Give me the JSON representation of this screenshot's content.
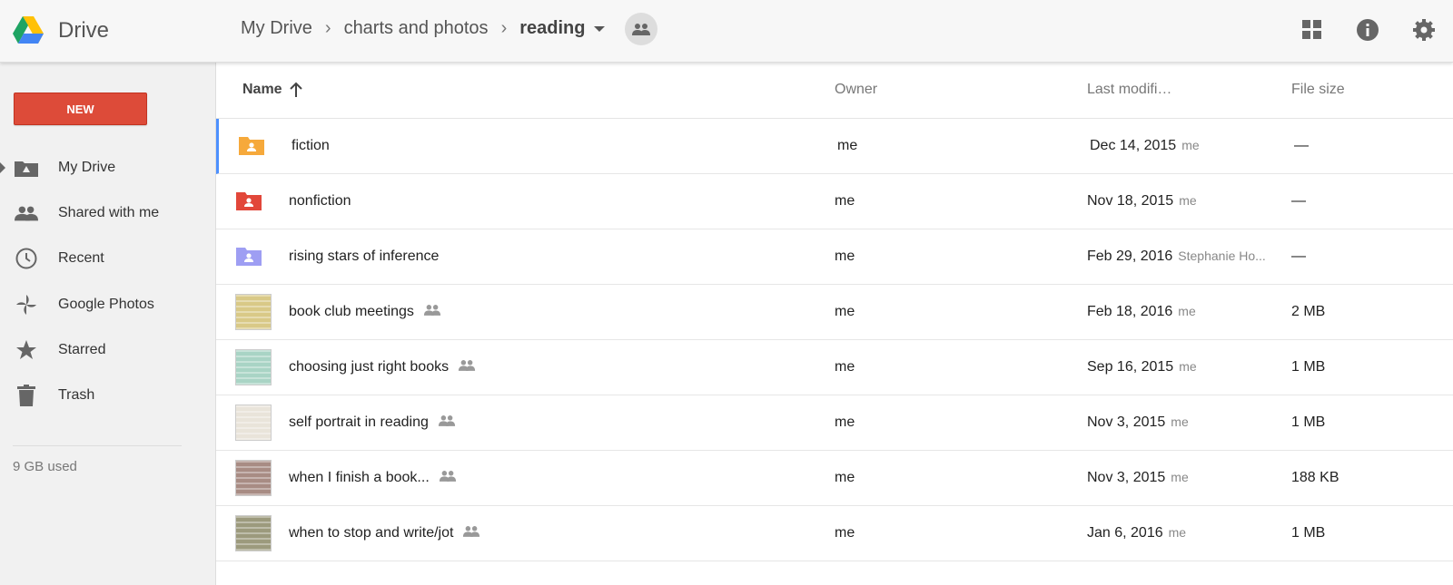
{
  "app": {
    "title": "Drive"
  },
  "breadcrumb": [
    "My Drive",
    "charts and photos",
    "reading"
  ],
  "header_icons": [
    "grid-view-icon",
    "info-icon",
    "settings-icon"
  ],
  "sidebar": {
    "new_label": "NEW",
    "items": [
      {
        "label": "My Drive",
        "icon": "my-drive-icon",
        "active": true
      },
      {
        "label": "Shared with me",
        "icon": "shared-people-icon"
      },
      {
        "label": "Recent",
        "icon": "clock-icon"
      },
      {
        "label": "Google Photos",
        "icon": "photos-pinwheel-icon"
      },
      {
        "label": "Starred",
        "icon": "star-icon"
      },
      {
        "label": "Trash",
        "icon": "trash-icon"
      }
    ],
    "storage_used": "9 GB used"
  },
  "columns": {
    "name": "Name",
    "owner": "Owner",
    "modified": "Last modifi…",
    "size": "File size"
  },
  "files": [
    {
      "name": "fiction",
      "type": "folder",
      "color": "#f6a93b",
      "shared": false,
      "owner": "me",
      "date": "Dec 14, 2015",
      "by": "me",
      "size": "—"
    },
    {
      "name": "nonfiction",
      "type": "folder",
      "color": "#e2473a",
      "shared": false,
      "owner": "me",
      "date": "Nov 18, 2015",
      "by": "me",
      "size": "—"
    },
    {
      "name": "rising stars of inference",
      "type": "folder",
      "color": "#9e9ef3",
      "shared": false,
      "owner": "me",
      "date": "Feb 29, 2016",
      "by": "Stephanie Ho...",
      "size": "—"
    },
    {
      "name": "book club meetings",
      "type": "image",
      "thumb": "#d9c987",
      "shared": true,
      "owner": "me",
      "date": "Feb 18, 2016",
      "by": "me",
      "size": "2 MB"
    },
    {
      "name": "choosing just right books",
      "type": "image",
      "thumb": "#a9d4c5",
      "shared": true,
      "owner": "me",
      "date": "Sep 16, 2015",
      "by": "me",
      "size": "1 MB"
    },
    {
      "name": "self portrait in reading",
      "type": "image",
      "thumb": "#e9e4da",
      "shared": true,
      "owner": "me",
      "date": "Nov 3, 2015",
      "by": "me",
      "size": "1 MB"
    },
    {
      "name": "when I finish a book...",
      "type": "image",
      "thumb": "#a88c84",
      "shared": true,
      "owner": "me",
      "date": "Nov 3, 2015",
      "by": "me",
      "size": "188 KB"
    },
    {
      "name": "when to stop and write/jot",
      "type": "image",
      "thumb": "#9c9a7d",
      "shared": true,
      "owner": "me",
      "date": "Jan 6, 2016",
      "by": "me",
      "size": "1 MB"
    }
  ]
}
